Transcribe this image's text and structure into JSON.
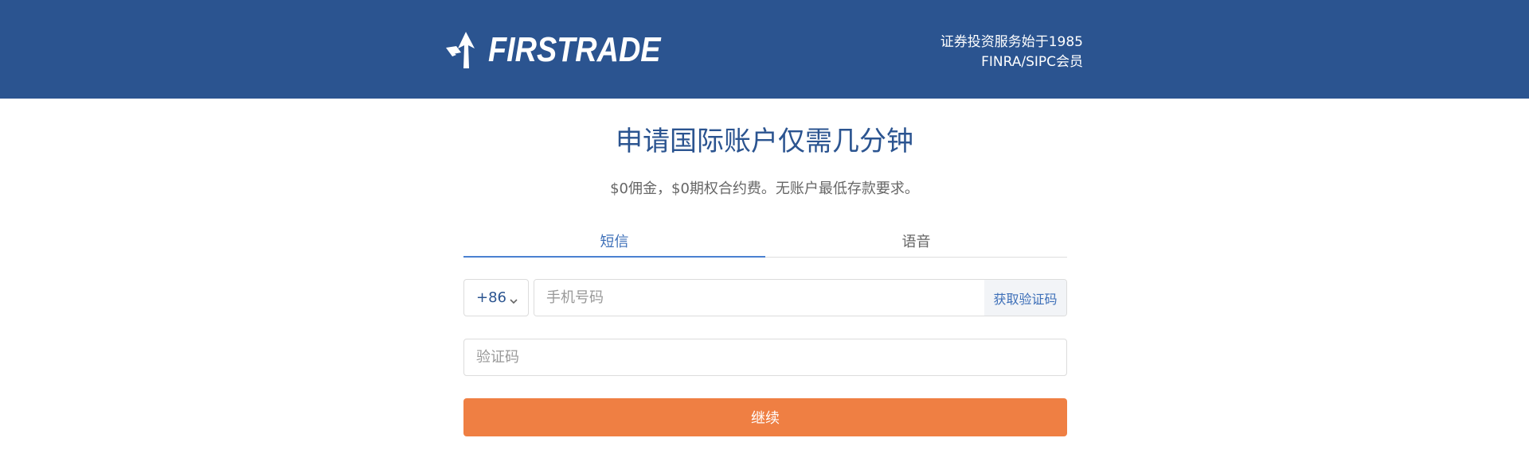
{
  "header": {
    "logo_text": "FIRSTRADE",
    "tagline_line1": "证券投资服务始于1985",
    "tagline_line2": "FINRA/SIPC会员",
    "background_color": "#2b5490"
  },
  "main": {
    "title": "申请国际账户仅需几分钟",
    "subtitle": "$0佣金，$0期权合约费。无账户最低存款要求。"
  },
  "tabs": [
    {
      "label": "短信",
      "active": true
    },
    {
      "label": "语音",
      "active": false
    }
  ],
  "form": {
    "country_code": "+86",
    "phone_placeholder": "手机号码",
    "get_code_label": "获取验证码",
    "code_placeholder": "验证码",
    "continue_label": "继续"
  },
  "colors": {
    "brand_blue": "#2b5490",
    "accent_orange": "#ef7f43",
    "link_blue": "#3d6fb8"
  },
  "icons": {
    "logo": "firstrade-arrow-logo-icon",
    "dropdown": "chevron-down-icon"
  }
}
